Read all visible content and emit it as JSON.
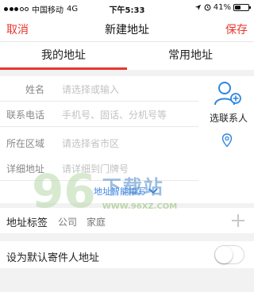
{
  "status_bar": {
    "carrier": "中国移动",
    "network": "4G",
    "time": "下午5:33",
    "battery": "41%",
    "battery_level": 0.41
  },
  "navbar": {
    "cancel_label": "取消",
    "title": "新建地址",
    "save_label": "保存"
  },
  "tabs": [
    {
      "label": "我的地址",
      "selected": true
    },
    {
      "label": "常用地址",
      "selected": false
    }
  ],
  "form": {
    "fields": [
      {
        "label": "姓名",
        "placeholder": "请选择或输入"
      },
      {
        "label": "联系电话",
        "placeholder": "手机号、固话、分机号等"
      },
      {
        "label": "所在区域",
        "placeholder": "请选择省市区"
      },
      {
        "label": "详细地址",
        "placeholder": "请详细到门牌号"
      }
    ],
    "select_contact_label": "选联系人",
    "more_toggle_label": "地址智能填写"
  },
  "address_tags": {
    "label": "地址标签",
    "options": [
      "公司",
      "家庭"
    ]
  },
  "default_sender": {
    "label": "设为默认寄件人地址",
    "enabled": false
  },
  "watermark": {
    "digits": "96",
    "site_name": "下载站",
    "url": "WWW.96XZ.COM"
  },
  "colors": {
    "accent": "#e8362f",
    "link": "#3d85e8"
  }
}
